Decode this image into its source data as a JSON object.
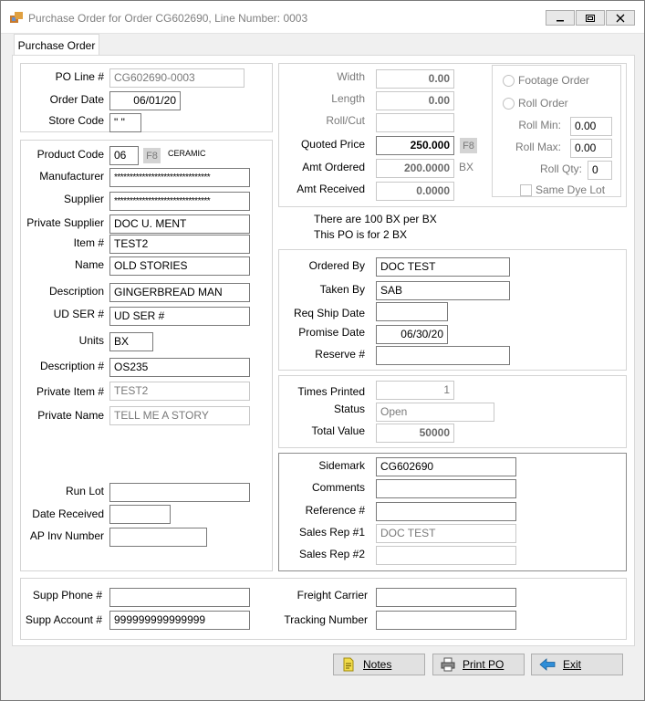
{
  "window": {
    "title": "Purchase Order for Order CG602690, Line Number: 0003",
    "icon": "app-icon",
    "minimize_icon": "minimize-icon",
    "maximize_icon": "maximize-icon",
    "close_icon": "close-icon"
  },
  "tab": {
    "label": "Purchase Order"
  },
  "header": {
    "po_line_label": "PO Line #",
    "po_line_value": "CG602690-0003",
    "order_date_label": "Order Date",
    "order_date_value": "06/01/20",
    "store_code_label": "Store Code",
    "store_code_value": "\" \""
  },
  "product": {
    "product_code_label": "Product Code",
    "product_code_value": "06",
    "f8": "F8",
    "product_code_desc": "CERAMIC",
    "manufacturer_label": "Manufacturer",
    "manufacturer_value": "*******************************",
    "supplier_label": "Supplier",
    "supplier_value": "*******************************",
    "private_supplier_label": "Private Supplier",
    "private_supplier_value": "DOC U. MENT",
    "item_label": "Item #",
    "item_value": "TEST2",
    "name_label": "Name",
    "name_value": "OLD STORIES",
    "description_label": "Description",
    "description_value": "GINGERBREAD MAN",
    "ud_ser_label": "UD SER #",
    "ud_ser_value": "UD SER #",
    "units_label": "Units",
    "units_value": "BX",
    "description_no_label": "Description #",
    "description_no_value": "OS235",
    "private_item_label": "Private Item #",
    "private_item_value": "TEST2",
    "private_name_label": "Private Name",
    "private_name_value": "TELL ME A STORY",
    "run_lot_label": "Run Lot",
    "run_lot_value": "",
    "date_received_label": "Date Received",
    "date_received_value": "",
    "ap_inv_label": "AP Inv Number",
    "ap_inv_value": ""
  },
  "dimensions": {
    "width_label": "Width",
    "width_value": "0.00",
    "length_label": "Length",
    "length_value": "0.00",
    "roll_cut_label": "Roll/Cut",
    "roll_cut_value": "",
    "quoted_price_label": "Quoted Price",
    "quoted_price_value": "250.000",
    "quoted_f8": "F8",
    "amt_ordered_label": "Amt Ordered",
    "amt_ordered_value": "200.0000",
    "amt_ordered_unit": "BX",
    "amt_received_label": "Amt Received",
    "amt_received_value": "0.0000"
  },
  "roll": {
    "footage_order_label": "Footage Order",
    "roll_order_label": "Roll Order",
    "roll_min_label": "Roll Min:",
    "roll_min_value": "0.00",
    "roll_max_label": "Roll Max:",
    "roll_max_value": "0.00",
    "roll_qty_label": "Roll Qty:",
    "roll_qty_value": "0",
    "same_dye_lot_label": "Same Dye Lot"
  },
  "info": {
    "line1": "There are 100 BX per BX",
    "line2": "This PO is for 2 BX"
  },
  "order": {
    "ordered_by_label": "Ordered By",
    "ordered_by_value": "DOC TEST",
    "taken_by_label": "Taken By",
    "taken_by_value": "SAB",
    "req_ship_label": "Req Ship Date",
    "req_ship_value": "",
    "promise_date_label": "Promise Date",
    "promise_date_value": "06/30/20",
    "reserve_label": "Reserve #",
    "reserve_value": ""
  },
  "status": {
    "times_printed_label": "Times Printed",
    "times_printed_value": "1",
    "status_label": "Status",
    "status_value": "Open",
    "total_value_label": "Total Value",
    "total_value_value": "50000"
  },
  "sidemark": {
    "sidemark_label": "Sidemark",
    "sidemark_value": "CG602690",
    "comments_label": "Comments",
    "comments_value": "",
    "reference_label": "Reference #",
    "reference_value": "",
    "sales_rep1_label": "Sales Rep #1",
    "sales_rep1_value": "DOC TEST",
    "sales_rep2_label": "Sales Rep #2",
    "sales_rep2_value": ""
  },
  "footer": {
    "supp_phone_label": "Supp Phone #",
    "supp_phone_value": "",
    "supp_account_label": "Supp Account #",
    "supp_account_value": "999999999999999",
    "freight_carrier_label": "Freight Carrier",
    "freight_carrier_value": "",
    "tracking_label": "Tracking Number",
    "tracking_value": ""
  },
  "buttons": {
    "notes_label": "Notes",
    "notes_icon": "notes-icon",
    "print_po_label": "Print PO",
    "print_icon": "printer-icon",
    "exit_label": "Exit",
    "exit_icon": "exit-arrow-icon"
  }
}
